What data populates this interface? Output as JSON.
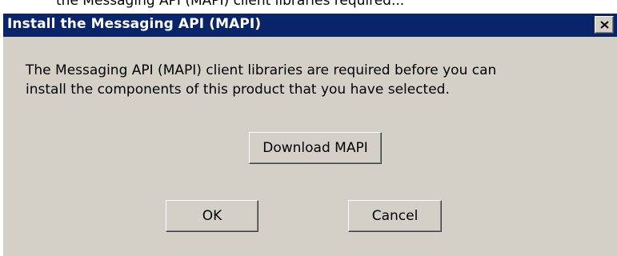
{
  "background_window": {
    "partial_text": "the Messaging API (MAPI) client libraries required..."
  },
  "dialog": {
    "title": "Install the Messaging API (MAPI)",
    "close_icon": "close-icon",
    "message_line1": "The Messaging API (MAPI) client libraries are required before you can",
    "message_line2": "install the components of this product that you have selected.",
    "download_label": "Download MAPI",
    "ok_label": "OK",
    "cancel_label": "Cancel"
  },
  "colors": {
    "title_bar": "#0a246a",
    "dialog_face": "#d4d0c8",
    "title_text": "#ffffff"
  }
}
